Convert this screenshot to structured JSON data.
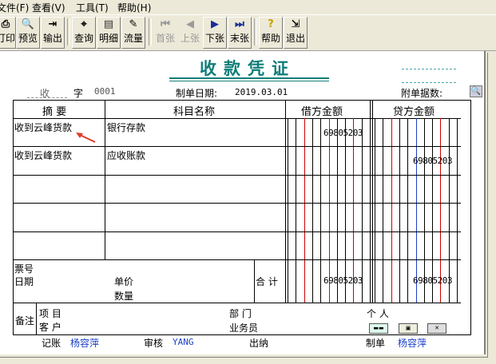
{
  "menu": [
    "文件(F)",
    "查看(V)",
    "工具(T)",
    "帮助(H)"
  ],
  "toolbar": {
    "print": "打印",
    "preview": "预览",
    "export": "输出",
    "query": "查询",
    "detail": "明细",
    "flow": "流量",
    "first": "首张",
    "prev": "上张",
    "next": "下张",
    "last": "末张",
    "help": "帮助",
    "exit": "退出"
  },
  "voucher": {
    "title": "收款凭证",
    "type_char": "收",
    "zi": "字",
    "number": "0001",
    "date_label": "制单日期:",
    "date": "2019.03.01",
    "attach_label": "附单据数:"
  },
  "columns": {
    "summary": "摘  要",
    "account": "科目名称",
    "debit": "借方金额",
    "credit": "贷方金额"
  },
  "rows": [
    {
      "summary": "收到云峰货款",
      "account": "银行存款",
      "debit": "6980520З",
      "credit": ""
    },
    {
      "summary": "收到云峰货款",
      "account": "应收账款",
      "debit": "",
      "credit": "6980520З"
    }
  ],
  "bottom": {
    "ticket_no": "票号",
    "date": "日期",
    "unit_price": "单价",
    "quantity": "数量",
    "total_label": "合 计",
    "total_debit": "6980520З",
    "total_credit": "6980520З"
  },
  "notes": {
    "label": "备注",
    "project": "项  目",
    "customer": "客  户",
    "dept": "部  门",
    "personal": "个  人",
    "clerk": "业务员"
  },
  "footer": {
    "bookkeeping_label": "记账",
    "bookkeeping": "杨容萍",
    "audit_label": "审核",
    "audit": "YANG",
    "cashier_label": "出纳",
    "maker_label": "制单",
    "maker": "杨容萍"
  }
}
